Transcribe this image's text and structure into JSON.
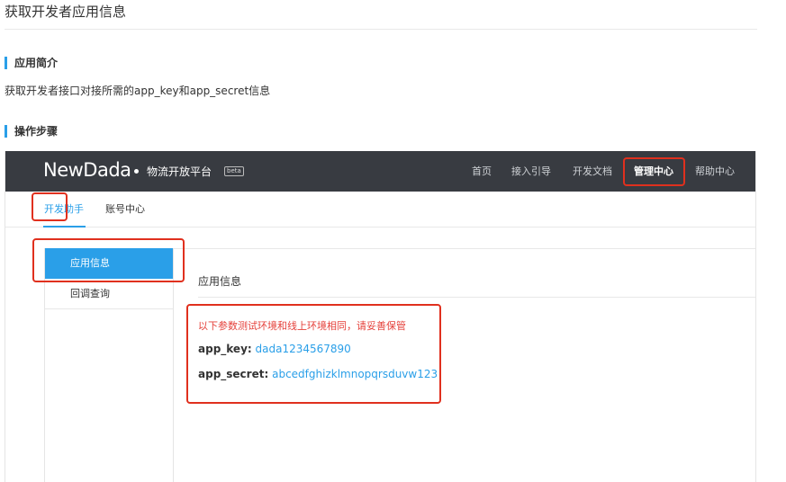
{
  "page": {
    "title": "获取开发者应用信息",
    "sections": {
      "intro_heading": "应用简介",
      "intro_text": "获取开发者接口对接所需的app_key和app_secret信息",
      "steps_heading": "操作步骤"
    }
  },
  "portal": {
    "logo": "NewDada",
    "platform": "物流开放平台",
    "beta": "beta",
    "nav": [
      "首页",
      "接入引导",
      "开发文档",
      "管理中心",
      "帮助中心"
    ],
    "subtabs": [
      "开发助手",
      "账号中心"
    ],
    "sidebar": [
      "应用信息",
      "回调查询"
    ],
    "panel": {
      "title": "应用信息",
      "notice": "以下参数测试环境和线上环境相同，请妥善保管",
      "app_key_label": "app_key:",
      "app_key_value": "dada1234567890",
      "app_secret_label": "app_secret:",
      "app_secret_value": "abcedfghizklmnopqrsduvw123"
    }
  },
  "colors": {
    "accent": "#2a9fe8",
    "topbar": "#383b41",
    "highlight": "#e0301e",
    "notice": "#e5403a"
  }
}
